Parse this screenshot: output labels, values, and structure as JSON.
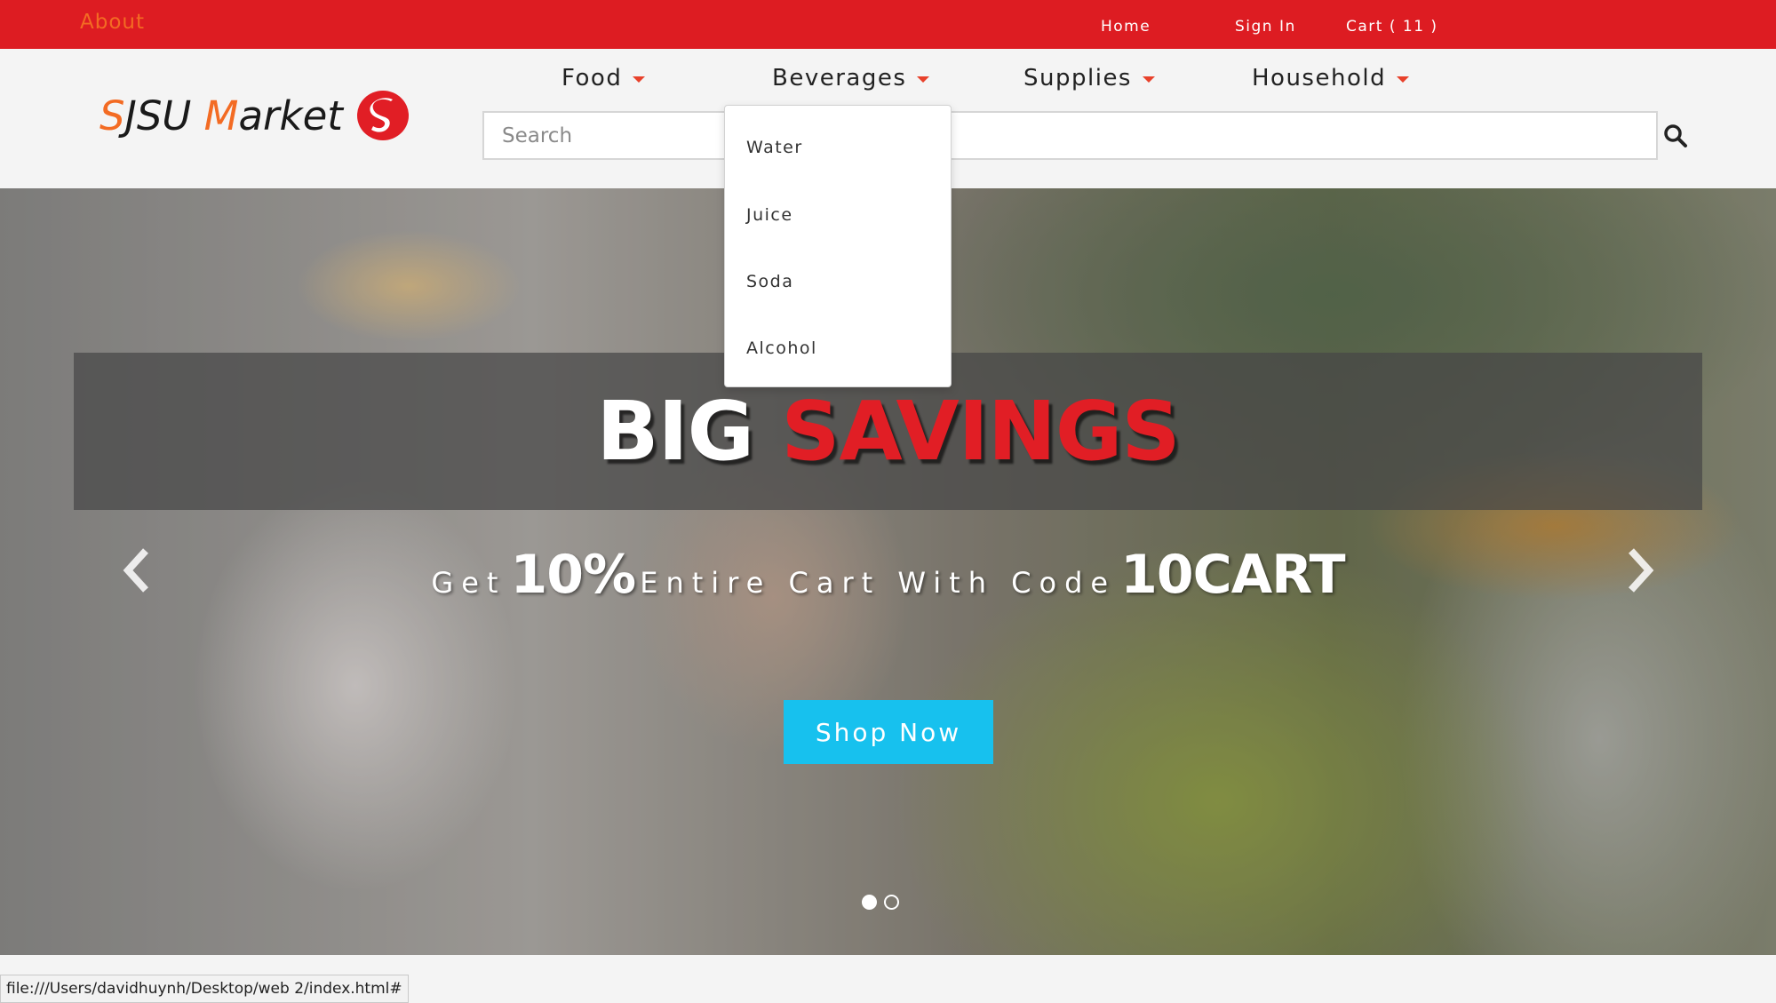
{
  "topbar": {
    "about": "About",
    "home": "Home",
    "sign_in": "Sign In",
    "cart": "Cart ( 11 )"
  },
  "logo": {
    "s": "S",
    "jsu": "JSU ",
    "m": "M",
    "arket": "arket"
  },
  "menu": {
    "food": "Food",
    "beverages": "Beverages",
    "supplies": "Supplies",
    "household": "Household"
  },
  "search": {
    "placeholder": "Search"
  },
  "beverages_dropdown": {
    "items": [
      "Water",
      "Juice",
      "Soda",
      "Alcohol"
    ]
  },
  "hero": {
    "headline_1": "BIG",
    "headline_2": "SAVINGS",
    "promo_get": "Get",
    "promo_pct": "10%",
    "promo_mid": "Entire Cart With Code",
    "promo_code": "10CART",
    "button": "Shop Now",
    "slides": 2,
    "active_slide": 1
  },
  "status_bar": {
    "url": "file:///Users/davidhuynh/Desktop/web 2/index.html#"
  },
  "colors": {
    "brand_red": "#dd1c22",
    "accent_orange": "#f36b23",
    "button_blue": "#17c1ee"
  }
}
